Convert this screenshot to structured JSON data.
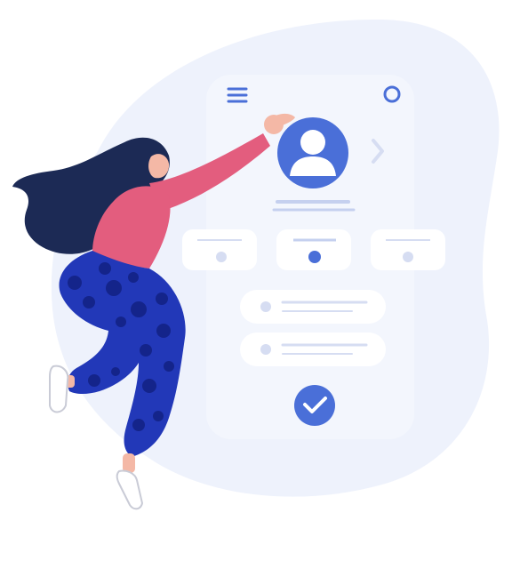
{
  "illustration": {
    "subject": "woman-reaching-for-profile-avatar",
    "colors": {
      "blob": "#eef2fc",
      "phone": "#f3f6fd",
      "card": "#ffffff",
      "accent": "#4a6fd8",
      "line": "#c5d0ef",
      "muted": "#d6ddf2",
      "hair": "#1c2a55",
      "skin": "#f4b8a6",
      "sweater": "#e35d7e",
      "pants": "#2238b8",
      "dots": "#14248a",
      "shoe": "#ffffff"
    },
    "phone": {
      "menu_icon": "hamburger-icon",
      "settings_icon": "settings-ring-icon",
      "avatar_icon": "user-avatar-icon",
      "next_icon": "chevron-right-icon",
      "confirm_icon": "checkmark-icon",
      "option_cards": [
        {
          "state": "inactive"
        },
        {
          "state": "active"
        },
        {
          "state": "inactive"
        }
      ],
      "list_rows": [
        {
          "state": "unchecked"
        },
        {
          "state": "unchecked"
        }
      ]
    }
  }
}
